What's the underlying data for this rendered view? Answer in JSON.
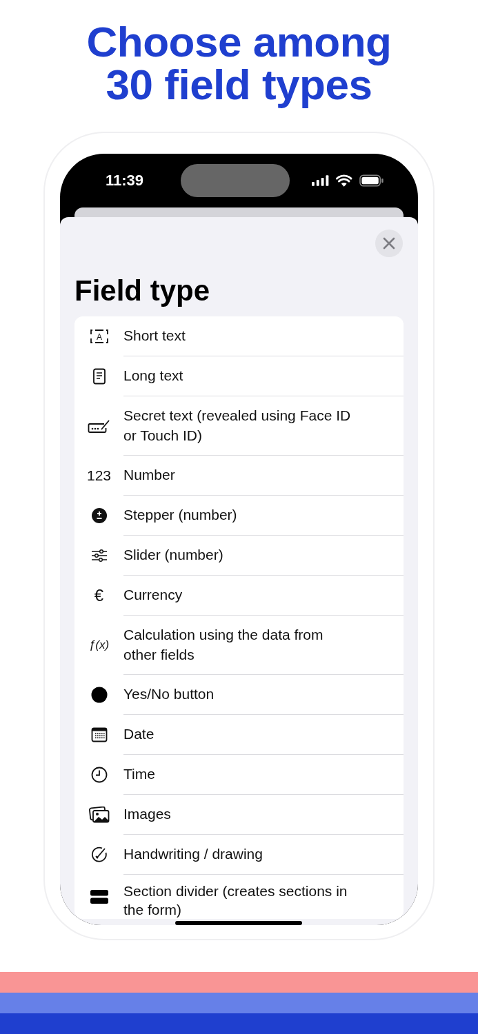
{
  "headline": [
    "Choose among",
    "30 field types"
  ],
  "status_bar": {
    "time": "11:39"
  },
  "sheet": {
    "title": "Field type",
    "items": [
      {
        "kind": "short-text",
        "icon_text": "A",
        "label": "Short text"
      },
      {
        "kind": "long-text",
        "label": "Long text"
      },
      {
        "kind": "secret",
        "label": "Secret text (revealed using Face ID or Touch ID)"
      },
      {
        "kind": "number",
        "icon_text": "123",
        "label": "Number"
      },
      {
        "kind": "stepper",
        "label": "Stepper (number)"
      },
      {
        "kind": "slider",
        "label": "Slider (number)"
      },
      {
        "kind": "currency",
        "icon_text": "€",
        "label": "Currency"
      },
      {
        "kind": "calculation",
        "icon_text": "ƒ(x)",
        "label": "Calculation using the data from other fields"
      },
      {
        "kind": "toggle",
        "label": "Yes/No button"
      },
      {
        "kind": "date",
        "label": "Date"
      },
      {
        "kind": "time",
        "label": "Time"
      },
      {
        "kind": "images",
        "label": "Images"
      },
      {
        "kind": "drawing",
        "label": "Handwriting / drawing"
      },
      {
        "kind": "divider",
        "label": "Section divider (creates sections in the form)"
      }
    ]
  }
}
